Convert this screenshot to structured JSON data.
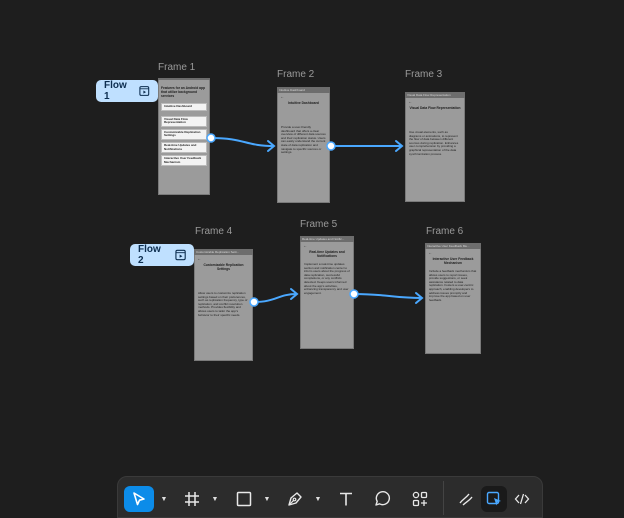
{
  "frames": [
    {
      "title": "Frame 1",
      "tab": "",
      "heading": "Features for an Android app that utilize background services",
      "items": [
        "Intuitive Dashboard",
        "Visual Data Flow Representation",
        "Customizable Replication Settings",
        "Real-time Updates and Notifications",
        "Interactive User Feedback Mechanism"
      ]
    },
    {
      "title": "Frame 2",
      "tab": "Intuitive Dashboard",
      "heading": "Intuitive Dashboard",
      "body": "Provide a user-friendly dashboard that offers a clear overview of different data sources and their replication status. Users can easily understand the current state of data replication and navigate to specific sources or settings."
    },
    {
      "title": "Frame 3",
      "tab": "Visual Data Flow Representation",
      "heading": "Visual Data Flow Representation",
      "body": "Use visual elements, such as diagrams or animations, to represent the flow of data between different sources during replication. Enhances user comprehension by providing a graphical representation of the data synchronization process."
    },
    {
      "title": "Frame 4",
      "tab": "Customizable Replication Setti...",
      "heading": "Customizable Replication Settings",
      "body": "Allow users to customize replication settings based on their preferences, such as replication frequency, type of replication, and conflict resolution methods. Provides flexibility and allows users to tailor the app's behavior to their specific needs."
    },
    {
      "title": "Frame 5",
      "tab": "Real-time Updates and Notific...",
      "heading": "Real-time Updates and Notifications",
      "body": "Implement a real-time updates section and notification center to inform users about the progress of data replication, successful completions, or any conflicts detected. Keeps users informed about the app's activities, enhancing transparency and user engagement."
    },
    {
      "title": "Frame 6",
      "tab": "Interactive User Feedback Me...",
      "heading": "Interactive User Feedback Mechanism",
      "body": "Include a feedback mechanism that allows users to report issues, provide suggestions, or seek assistance related to data replication. Fosters a user-centric approach, enabling developers to address issues promptly and improve the app based on user feedback."
    }
  ],
  "flows": [
    {
      "label": "Flow 1",
      "icon": "play-frame-icon"
    },
    {
      "label": "Flow 2",
      "icon": "play-frame-icon"
    }
  ],
  "toolbar": {
    "tools": [
      {
        "name": "move-tool",
        "icon": "cursor-arrow-icon",
        "active": true,
        "dropdown": true
      },
      {
        "name": "frame-tool",
        "icon": "hash-frame-icon",
        "active": false,
        "dropdown": true
      },
      {
        "name": "shape-tool",
        "icon": "rectangle-icon",
        "active": false,
        "dropdown": true
      },
      {
        "name": "pen-tool",
        "icon": "pen-nib-icon",
        "active": false,
        "dropdown": true
      },
      {
        "name": "text-tool",
        "icon": "text-t-icon",
        "active": false,
        "dropdown": false
      },
      {
        "name": "comment-tool",
        "icon": "comment-bubble-icon",
        "active": false,
        "dropdown": false
      },
      {
        "name": "actions-tool",
        "icon": "shapes-plus-icon",
        "active": false,
        "dropdown": false
      }
    ],
    "modes": [
      {
        "name": "draw-mode",
        "icon": "draw-pencil-icon",
        "selected": false
      },
      {
        "name": "design-mode",
        "icon": "design-cursor-icon",
        "selected": true
      },
      {
        "name": "dev-mode",
        "icon": "code-brackets-icon",
        "selected": false
      }
    ]
  },
  "colors": {
    "canvas": "#1e1e1e",
    "frame_fill": "#9b9b9b",
    "connector": "#4aa8ff",
    "flow_badge": "#bfe0ff",
    "toolbar": "#2c2c2c",
    "active_tool": "#0c8ce9"
  }
}
